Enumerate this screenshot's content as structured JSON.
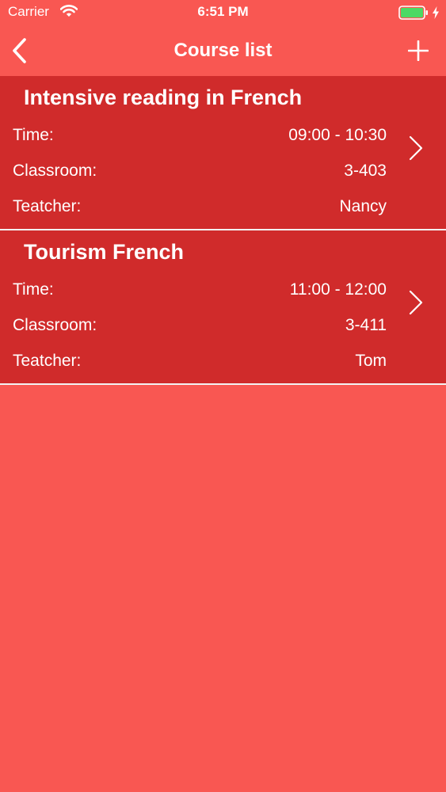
{
  "status_bar": {
    "carrier": "Carrier",
    "time": "6:51 PM",
    "battery_color": "#4CD964"
  },
  "nav": {
    "title": "Course list",
    "back_icon": "chevron-left-icon",
    "add_icon": "plus-icon"
  },
  "labels": {
    "time": "Time:",
    "classroom": "Classroom:",
    "teacher": "Teatcher:"
  },
  "courses": [
    {
      "name": "Intensive reading in French",
      "time": "09:00 - 10:30",
      "classroom": "3-403",
      "teacher": "Nancy"
    },
    {
      "name": "Tourism French",
      "time": "11:00 - 12:00",
      "classroom": "3-411",
      "teacher": "Tom"
    }
  ],
  "colors": {
    "background": "#F95752",
    "row_background": "#D02B2B",
    "separator": "#F3F3F3",
    "text": "#FFFFFF"
  }
}
